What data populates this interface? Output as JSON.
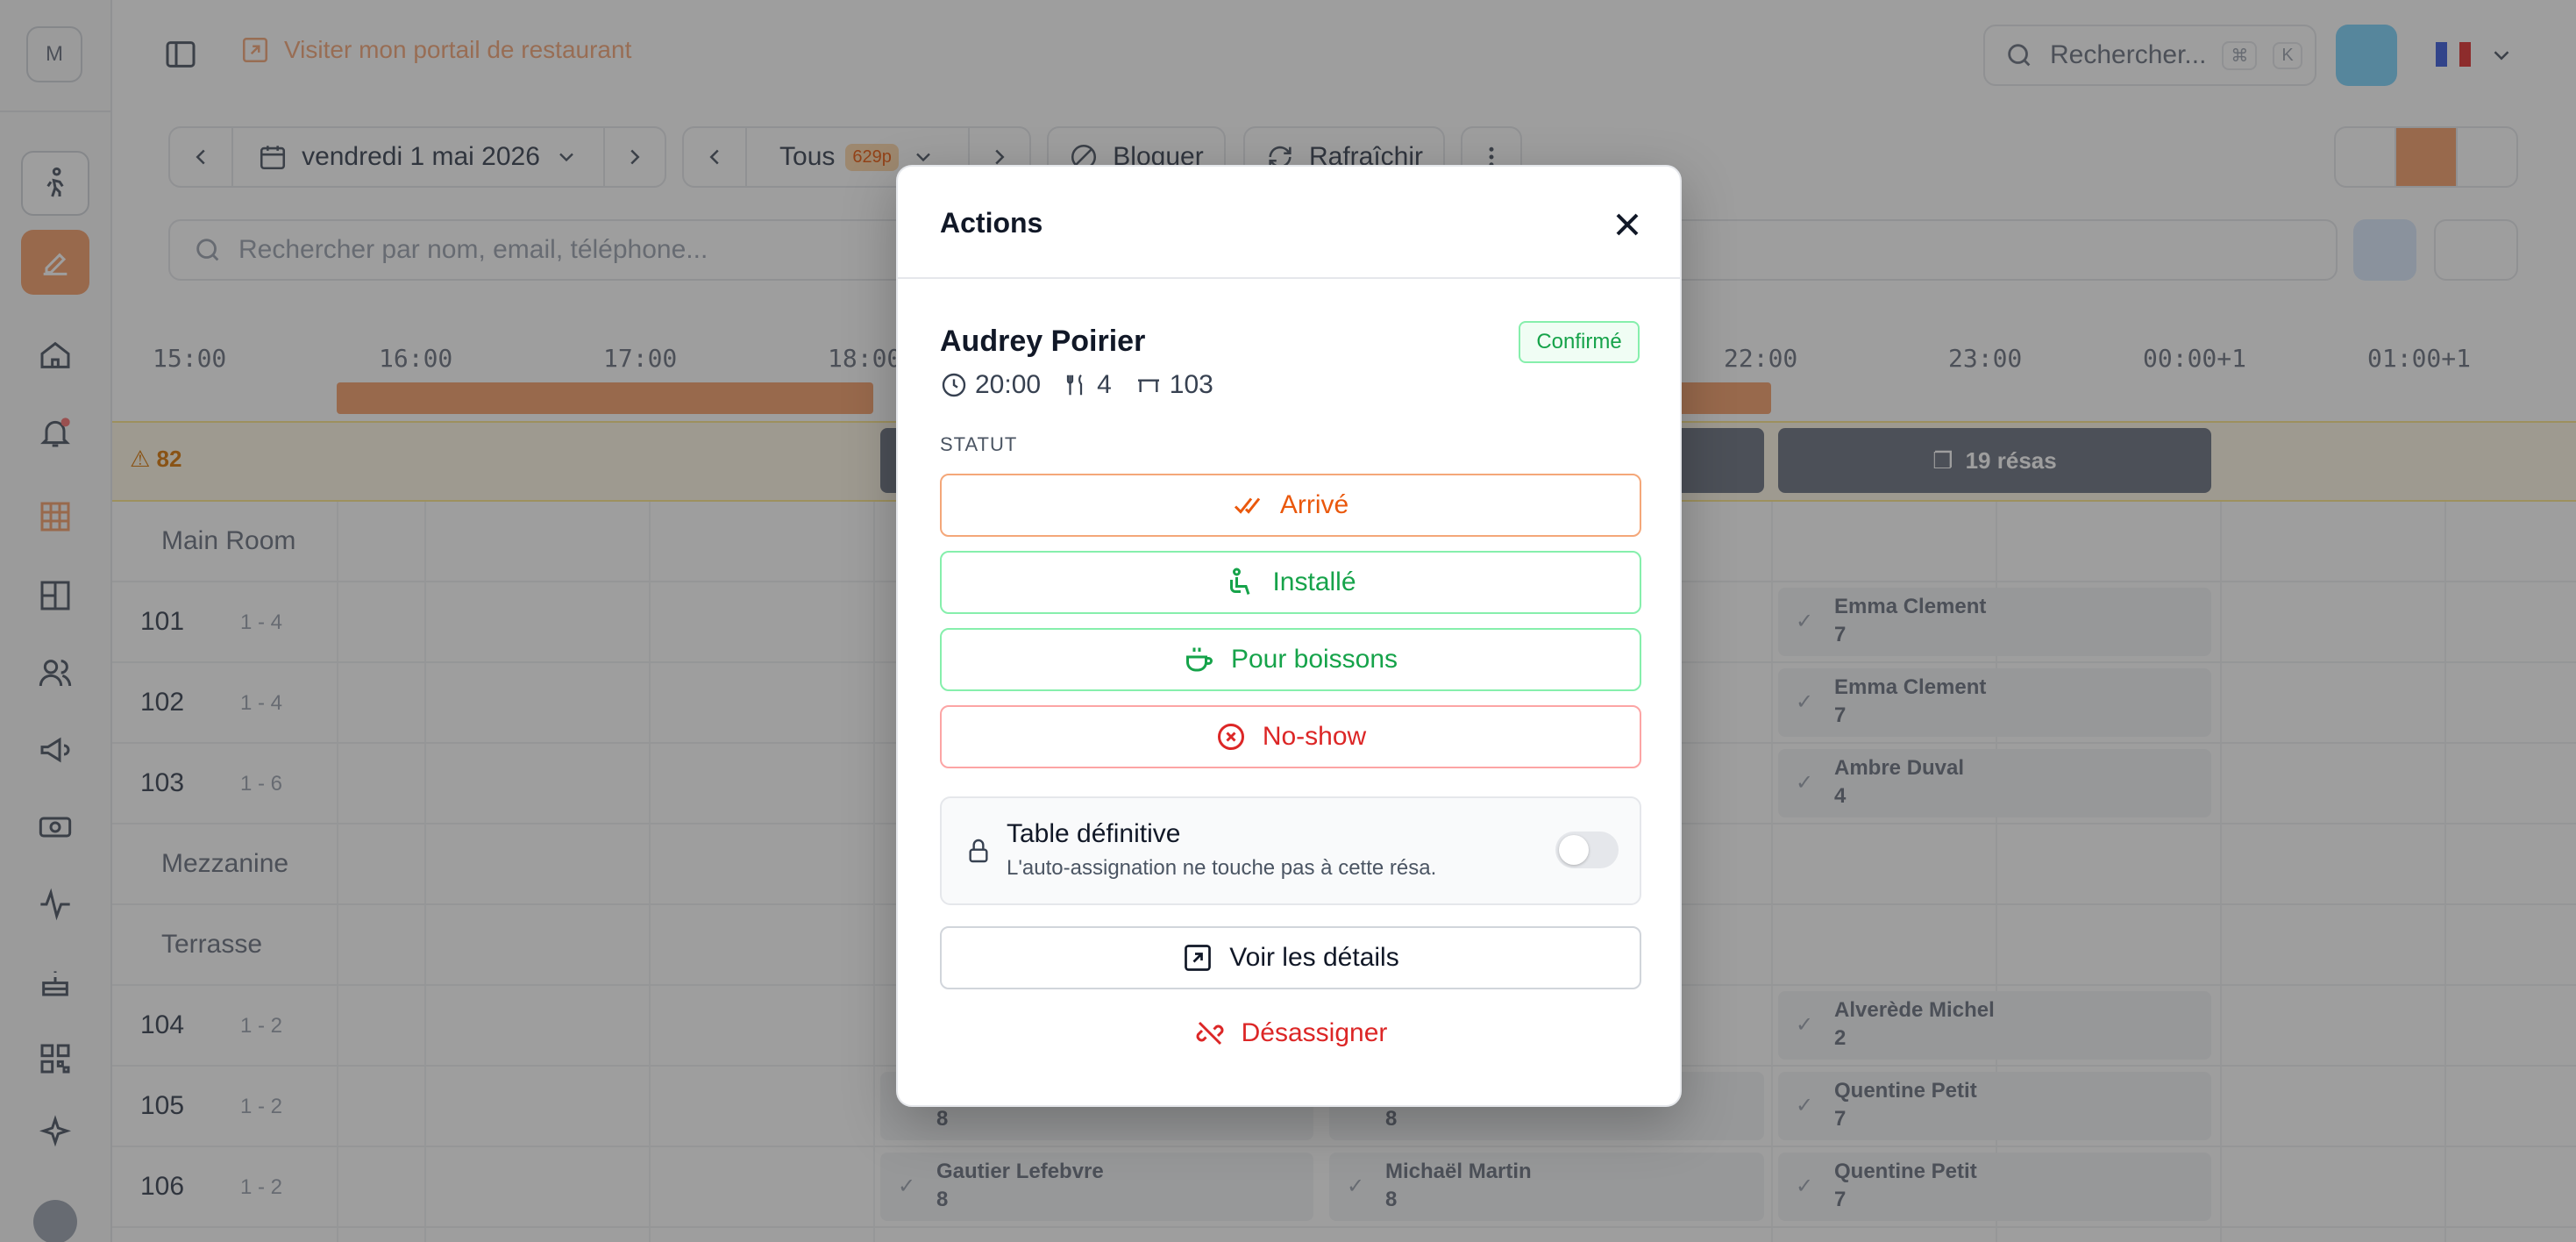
{
  "app": {
    "workspace_initial": "M",
    "portal_link": "Visiter mon portail de restaurant",
    "search_placeholder": "Rechercher...",
    "search_kbd1": "⌘",
    "search_kbd2": "K",
    "colors": {
      "accent": "#f59e6b",
      "confirmed": "#16a34a",
      "danger": "#dc2626"
    }
  },
  "toolbar": {
    "date": "vendredi 1 mai 2026",
    "filter": "Tous",
    "filter_count": "629p",
    "block": "Bloquer",
    "refresh": "Rafraîchir",
    "search_placeholder": "Rechercher par nom, email, téléphone..."
  },
  "timeline": {
    "hours": [
      "15:00",
      "16:00",
      "17:00",
      "18:00",
      "22:00",
      "23:00",
      "00:00+1",
      "01:00+1"
    ],
    "alert_count": "82",
    "resa_chip": "19 résas",
    "sections": [
      "Main Room",
      "Mezzanine",
      "Terrasse"
    ],
    "tables": [
      {
        "num": "101",
        "cap": "1 - 4"
      },
      {
        "num": "102",
        "cap": "1 - 4"
      },
      {
        "num": "103",
        "cap": "1 - 6"
      },
      {
        "num": "104",
        "cap": "1 - 2"
      },
      {
        "num": "105",
        "cap": "1 - 2"
      },
      {
        "num": "106",
        "cap": "1 - 2"
      }
    ],
    "cards": [
      {
        "name": "Emma Clement",
        "covers": "7"
      },
      {
        "name": "Emma Clement",
        "covers": "7"
      },
      {
        "name": "Ambre Duval",
        "covers": "4"
      },
      {
        "name": "Alverède Michel",
        "covers": "2"
      },
      {
        "name": "Quentine Petit",
        "covers": "7"
      },
      {
        "name": "Quentine Petit",
        "covers": "7"
      },
      {
        "name": "Gautier Lefebvre",
        "covers": "8"
      },
      {
        "name": "Michaël Martin",
        "covers": "8"
      },
      {
        "name": "",
        "covers": "8"
      },
      {
        "name": "",
        "covers": "8"
      }
    ]
  },
  "modal": {
    "title": "Actions",
    "guest_name": "Audrey Poirier",
    "status": "Confirmé",
    "time": "20:00",
    "covers": "4",
    "table": "103",
    "section_label": "STATUT",
    "actions": {
      "arrive": "Arrivé",
      "installe": "Installé",
      "boissons": "Pour boissons",
      "noshow": "No-show"
    },
    "lock_title": "Table définitive",
    "lock_desc": "L'auto-assignation ne touche pas à cette résa.",
    "details": "Voir les détails",
    "unassign": "Désassigner"
  }
}
